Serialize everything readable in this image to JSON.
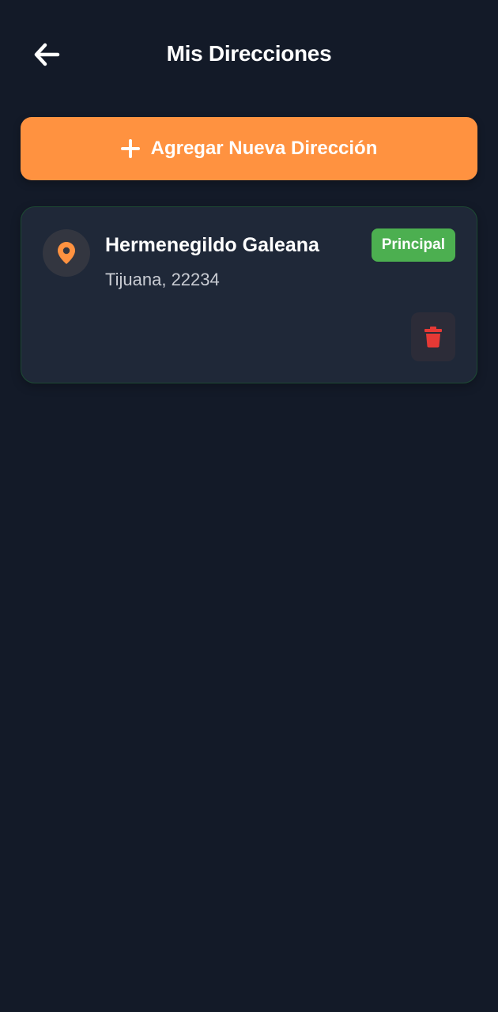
{
  "header": {
    "title": "Mis Direcciones",
    "back_icon": "arrow-left-icon"
  },
  "actions": {
    "add_address_label": "Agregar Nueva Dirección",
    "add_icon": "plus-icon"
  },
  "addresses": [
    {
      "name": "Hermenegildo Galeana",
      "detail": "Tijuana, 22234",
      "badge": "Principal",
      "icon": "map-pin-icon",
      "delete_icon": "trash-icon"
    }
  ],
  "colors": {
    "background": "#131a28",
    "card": "#1f2838",
    "accent": "#ff9240",
    "badge": "#4caf50",
    "delete": "#e53935"
  }
}
